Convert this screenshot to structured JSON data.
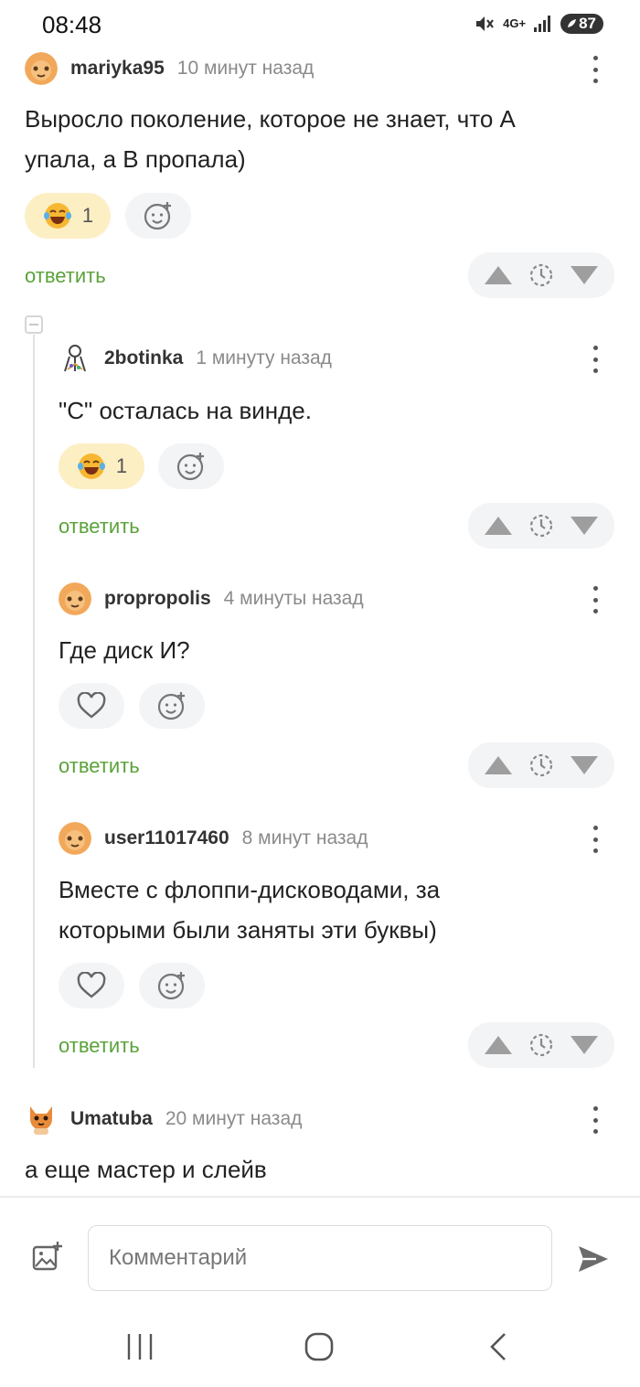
{
  "status_bar": {
    "time": "08:48",
    "network": "4G+",
    "battery": "87"
  },
  "comments": [
    {
      "user": "mariyka95",
      "time_ago": "10 минут назад",
      "text_lines": [
        "Выросло поколение, которое не знает, что А",
        "упала, а В пропала)"
      ],
      "reaction": {
        "emoji": "laughing-tears-icon",
        "count": "1"
      },
      "reply_label": "ответить"
    },
    {
      "user": "2botinka",
      "time_ago": "1 минуту назад",
      "text_lines": [
        "\"С\" осталась на винде."
      ],
      "reaction": {
        "emoji": "laughing-tears-icon",
        "count": "1"
      },
      "reply_label": "ответить"
    },
    {
      "user": "propropolis",
      "time_ago": "4 минуты назад",
      "text_lines": [
        "Где диск И?"
      ],
      "reply_label": "ответить"
    },
    {
      "user": "user11017460",
      "time_ago": "8 минут назад",
      "text_lines": [
        "Вместе с флоппи-дисководами, за",
        "которыми были заняты эти буквы)"
      ],
      "reply_label": "ответить"
    },
    {
      "user": "Umatuba",
      "time_ago": "20 минут назад",
      "text_lines": [
        "а еще мастер и слейв"
      ]
    }
  ],
  "composer": {
    "placeholder": "Комментарий"
  },
  "colors": {
    "reply": "#5aa23a",
    "reaction_bg": "#fdefc4",
    "pill_bg": "#f3f4f6"
  }
}
